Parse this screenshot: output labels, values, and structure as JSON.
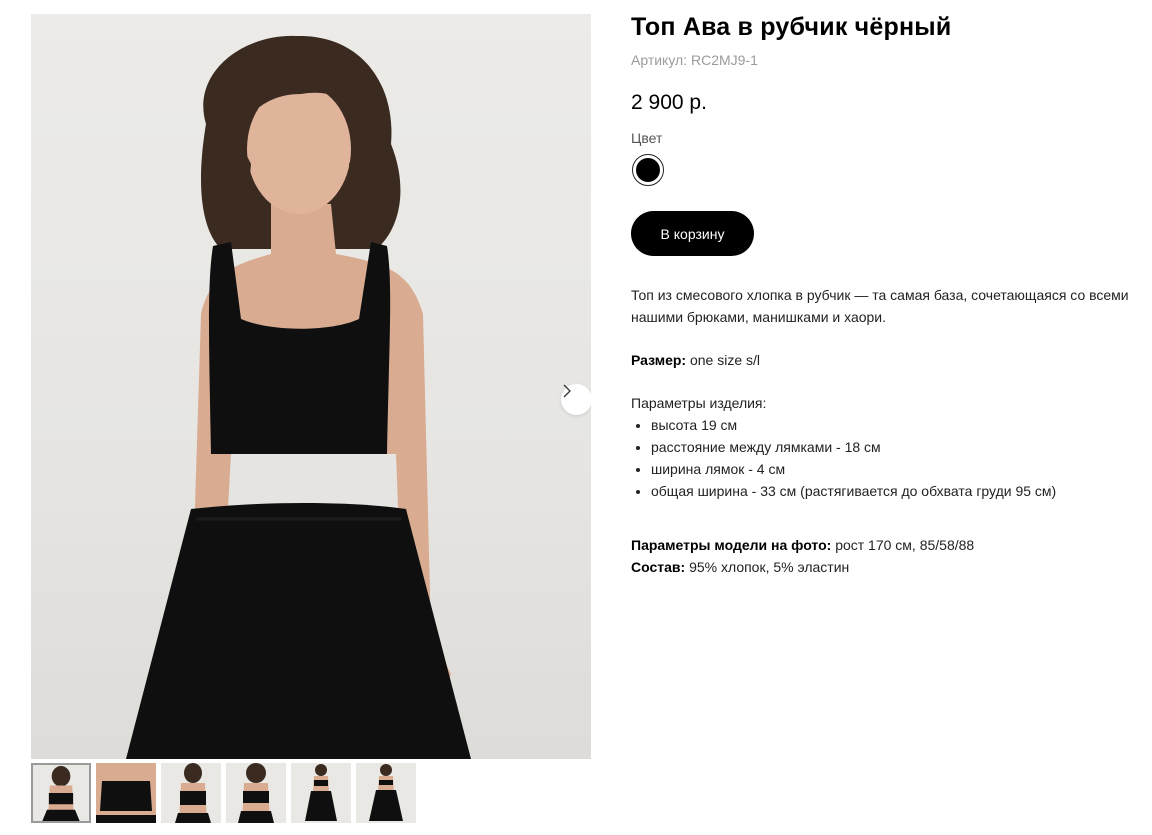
{
  "product": {
    "title": "Топ Ава в рубчик чёрный",
    "sku": "Артикул: RC2MJ9-1",
    "price": "2 900 р.",
    "color_label": "Цвет",
    "colors": [
      {
        "name": "чёрный",
        "hex": "#000000",
        "selected": true
      }
    ],
    "cart_button": "В корзину"
  },
  "description": {
    "intro": "Топ из смесового хлопка в рубчик — та самая база, сочетающаяся со всеми нашими брюками, манишками и хаори.",
    "size_label": "Размер:",
    "size_value": "one size s/l",
    "params_heading": "Параметры изделия:",
    "params": [
      "высота 19 см",
      "расстояние между лямками - 18 см",
      "ширина лямок - 4 см",
      "общая ширина - 33 см (растягивается до обхвата груди 95 см)"
    ],
    "model_label": "Параметры модели на фото:",
    "model_value": "рост 170 см, 85/58/88",
    "composition_label": "Состав:",
    "composition_value": "95% хлопок, 5% эластин"
  },
  "gallery": {
    "next_icon": "chevron-right-icon",
    "thumbnail_count": 6,
    "active_thumbnail": 1
  },
  "colors": {
    "background": "#ffffff",
    "photo_background": "#e8e7e3",
    "garment": "#0f0f0f",
    "skin": "#d9ab91",
    "hair": "#3a2a20",
    "button": "#000000"
  }
}
